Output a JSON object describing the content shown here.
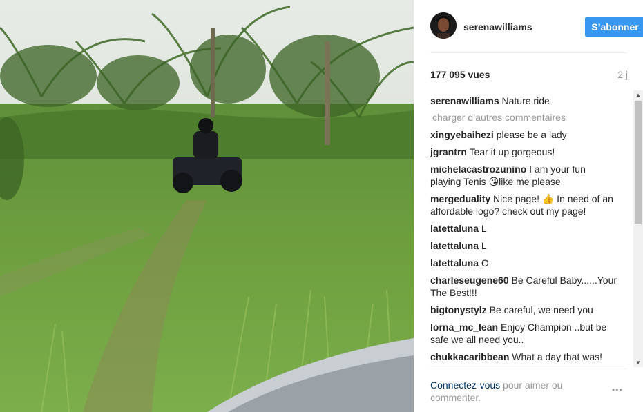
{
  "header": {
    "username": "serenawilliams",
    "follow_label": "S’abonner"
  },
  "stats": {
    "views": "177 095 vues",
    "time": "2 j"
  },
  "caption": {
    "user": "serenawilliams",
    "text": "Nature ride"
  },
  "load_more_label": "charger d’autres commentaires",
  "comments": [
    {
      "user": "xingyebaihezi",
      "text": "please be a lady"
    },
    {
      "user": "jgrantrn",
      "text": "Tear it up gorgeous!"
    },
    {
      "user": "michelacastrozunino",
      "text": "I am your fun playing Tenis 😘like me please"
    },
    {
      "user": "mergeduality",
      "text": "Nice page! 👍 In need of an affordable logo? check out my page!"
    },
    {
      "user": "latettaluna",
      "text": "L"
    },
    {
      "user": "latettaluna",
      "text": "L"
    },
    {
      "user": "latettaluna",
      "text": "O"
    },
    {
      "user": "charleseugene60",
      "text": "Be Careful Baby......Your The Best!!!"
    },
    {
      "user": "bigtonystylz",
      "text": "Be careful, we need you"
    },
    {
      "user": "lorna_mc_lean",
      "text": "Enjoy Champion ..but be safe we all need you.."
    },
    {
      "user": "chukkacaribbean",
      "text": "What a day that was!"
    }
  ],
  "footer": {
    "login_link": "Connectez-vous",
    "login_rest": " pour aimer ou commenter.",
    "more_icon": "•••"
  },
  "colors": {
    "accent": "#3897f0",
    "link": "#003569",
    "muted": "#999999"
  }
}
